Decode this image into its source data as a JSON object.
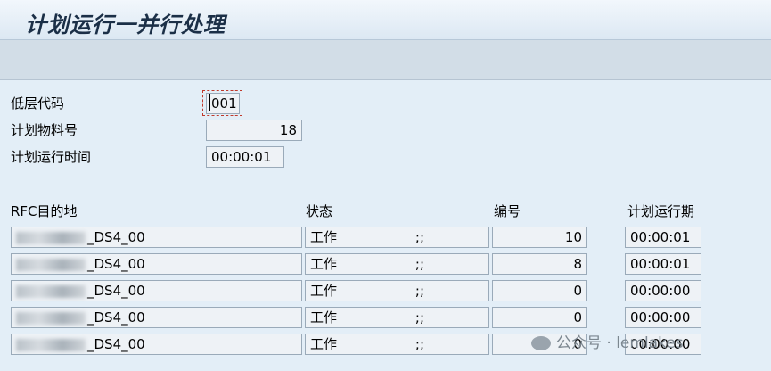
{
  "window": {
    "title": "计划运行一并行处理"
  },
  "params": {
    "low_level_code_label": "低层代码",
    "low_level_code_value": "001",
    "planned_materials_label": "计划物料号",
    "planned_materials_value": "18",
    "planning_runtime_label": "计划运行时间",
    "planning_runtime_value": "00:00:01"
  },
  "table": {
    "headers": {
      "destination": "RFC目的地",
      "status": "状态",
      "number": "编号",
      "runtime": "计划运行期"
    },
    "rows": [
      {
        "destination": "_DS4_00",
        "status": "工作",
        "sep": ";;",
        "number": "10",
        "runtime": "00:00:01"
      },
      {
        "destination": "_DS4_00",
        "status": "工作",
        "sep": ";;",
        "number": "8",
        "runtime": "00:00:01"
      },
      {
        "destination": "_DS4_00",
        "status": "工作",
        "sep": ";;",
        "number": "0",
        "runtime": "00:00:00"
      },
      {
        "destination": "_DS4_00",
        "status": "工作",
        "sep": ";;",
        "number": "0",
        "runtime": "00:00:00"
      },
      {
        "destination": "_DS4_00",
        "status": "工作",
        "sep": ";;",
        "number": "0",
        "runtime": "00:00:00"
      }
    ]
  },
  "watermark": {
    "text": "公众号 · lemlakes",
    "icon": "wechat-icon"
  }
}
